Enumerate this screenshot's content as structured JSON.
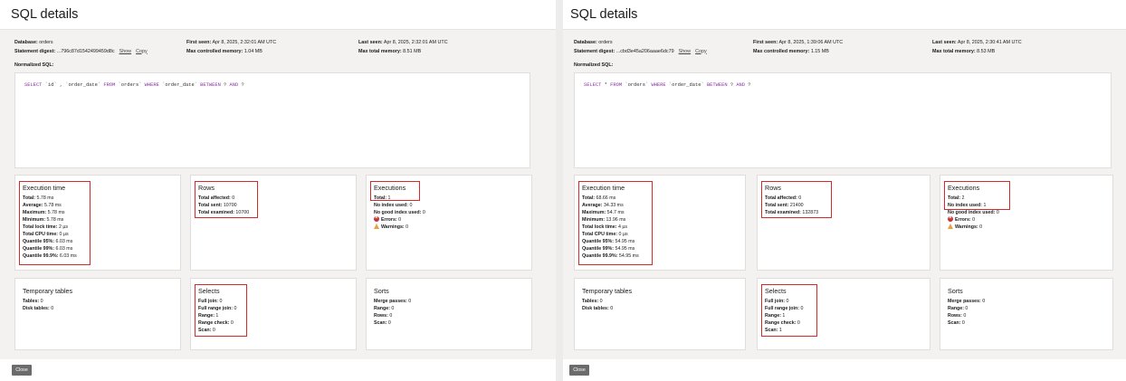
{
  "left": {
    "title": "SQL details",
    "meta": {
      "database_label": "Database:",
      "database": "orders",
      "digest_label": "Statement digest:",
      "digest": "...796c87d1542499459d8c",
      "show_label": "Show",
      "copy_label": "Copy",
      "first_seen_label": "First seen:",
      "first_seen": "Apr 8, 2025, 2:32:01 AM UTC",
      "max_controlled_label": "Max controlled memory:",
      "max_controlled": "1.04 MB",
      "last_seen_label": "Last seen:",
      "last_seen": "Apr 8, 2025, 2:32:01 AM UTC",
      "max_total_label": "Max total memory:",
      "max_total": "8.51 MB",
      "normalized_label": "Normalized SQL:"
    },
    "sql": [
      {
        "t": "SELECT",
        "k": true
      },
      {
        "t": " `id` , `order_date` ",
        "k": false
      },
      {
        "t": "FROM",
        "k": true
      },
      {
        "t": " `orders` ",
        "k": false
      },
      {
        "t": "WHERE",
        "k": true
      },
      {
        "t": " `order_date` ",
        "k": false
      },
      {
        "t": "BETWEEN",
        "k": true
      },
      {
        "t": " ? ",
        "k": false
      },
      {
        "t": "AND",
        "k": true
      },
      {
        "t": " ?",
        "k": false
      }
    ],
    "execution_time": {
      "title": "Execution time",
      "items": [
        {
          "label": "Total:",
          "value": "5.78 ms"
        },
        {
          "label": "Average:",
          "value": "5.78 ms"
        },
        {
          "label": "Maximum:",
          "value": "5.78 ms"
        },
        {
          "label": "Minimum:",
          "value": "5.78 ms"
        },
        {
          "label": "Total lock time:",
          "value": "2 µs"
        },
        {
          "label": "Total CPU time:",
          "value": "0 µs"
        },
        {
          "label": "Quantile 95%:",
          "value": "6.03 ms"
        },
        {
          "label": "Quantile 99%:",
          "value": "6.03 ms"
        },
        {
          "label": "Quantile 99.9%:",
          "value": "6.03 ms"
        }
      ]
    },
    "rows": {
      "title": "Rows",
      "items": [
        {
          "label": "Total affected:",
          "value": "0"
        },
        {
          "label": "Total sent:",
          "value": "10700"
        },
        {
          "label": "Total examined:",
          "value": "10700"
        }
      ]
    },
    "executions": {
      "title": "Executions",
      "items": [
        {
          "label": "Total:",
          "value": "1"
        },
        {
          "label": "No index used:",
          "value": "0"
        },
        {
          "label": "No good index used:",
          "value": "0"
        },
        {
          "label": "Errors:",
          "value": "0",
          "icon": "error-icon"
        },
        {
          "label": "Warnings:",
          "value": "0",
          "icon": "warning-icon"
        }
      ]
    },
    "temporary_tables": {
      "title": "Temporary tables",
      "items": [
        {
          "label": "Tables:",
          "value": "0"
        },
        {
          "label": "Disk tables:",
          "value": "0"
        }
      ]
    },
    "selects": {
      "title": "Selects",
      "items": [
        {
          "label": "Full join:",
          "value": "0"
        },
        {
          "label": "Full range join:",
          "value": "0"
        },
        {
          "label": "Range:",
          "value": "1"
        },
        {
          "label": "Range check:",
          "value": "0"
        },
        {
          "label": "Scan:",
          "value": "0"
        }
      ]
    },
    "sorts": {
      "title": "Sorts",
      "items": [
        {
          "label": "Merge passes:",
          "value": "0"
        },
        {
          "label": "Range:",
          "value": "0"
        },
        {
          "label": "Rows:",
          "value": "0"
        },
        {
          "label": "Scan:",
          "value": "0"
        }
      ]
    },
    "close_label": "Close"
  },
  "right": {
    "title": "SQL details",
    "meta": {
      "database_label": "Database:",
      "database": "orders",
      "digest_label": "Statement digest:",
      "digest": "...cbd3e45a206aaae6dc79",
      "show_label": "Show",
      "copy_label": "Copy",
      "first_seen_label": "First seen:",
      "first_seen": "Apr 8, 2025, 1:39:06 AM UTC",
      "max_controlled_label": "Max controlled memory:",
      "max_controlled": "1.15 MB",
      "last_seen_label": "Last seen:",
      "last_seen": "Apr 8, 2025, 2:30:41 AM UTC",
      "max_total_label": "Max total memory:",
      "max_total": "8.53 MB",
      "normalized_label": "Normalized SQL:"
    },
    "sql": [
      {
        "t": "SELECT",
        "k": true
      },
      {
        "t": " * ",
        "k": false
      },
      {
        "t": "FROM",
        "k": true
      },
      {
        "t": " `orders` ",
        "k": false
      },
      {
        "t": "WHERE",
        "k": true
      },
      {
        "t": " `order_date` ",
        "k": false
      },
      {
        "t": "BETWEEN",
        "k": true
      },
      {
        "t": " ? ",
        "k": false
      },
      {
        "t": "AND",
        "k": true
      },
      {
        "t": " ?",
        "k": false
      }
    ],
    "execution_time": {
      "title": "Execution time",
      "items": [
        {
          "label": "Total:",
          "value": "68.66 ms"
        },
        {
          "label": "Average:",
          "value": "34.33 ms"
        },
        {
          "label": "Maximum:",
          "value": "54.7 ms"
        },
        {
          "label": "Minimum:",
          "value": "13.96 ms"
        },
        {
          "label": "Total lock time:",
          "value": "4 µs"
        },
        {
          "label": "Total CPU time:",
          "value": "0 µs"
        },
        {
          "label": "Quantile 95%:",
          "value": "54.95 ms"
        },
        {
          "label": "Quantile 99%:",
          "value": "54.95 ms"
        },
        {
          "label": "Quantile 99.9%:",
          "value": "54.95 ms"
        }
      ]
    },
    "rows": {
      "title": "Rows",
      "items": [
        {
          "label": "Total affected:",
          "value": "0"
        },
        {
          "label": "Total sent:",
          "value": "21400"
        },
        {
          "label": "Total examined:",
          "value": "132873"
        }
      ]
    },
    "executions": {
      "title": "Executions",
      "items": [
        {
          "label": "Total:",
          "value": "2"
        },
        {
          "label": "No index used:",
          "value": "1"
        },
        {
          "label": "No good index used:",
          "value": "0"
        },
        {
          "label": "Errors:",
          "value": "0",
          "icon": "error-icon"
        },
        {
          "label": "Warnings:",
          "value": "0",
          "icon": "warning-icon"
        }
      ]
    },
    "temporary_tables": {
      "title": "Temporary tables",
      "items": [
        {
          "label": "Tables:",
          "value": "0"
        },
        {
          "label": "Disk tables:",
          "value": "0"
        }
      ]
    },
    "selects": {
      "title": "Selects",
      "items": [
        {
          "label": "Full join:",
          "value": "0"
        },
        {
          "label": "Full range join:",
          "value": "0"
        },
        {
          "label": "Range:",
          "value": "1"
        },
        {
          "label": "Range check:",
          "value": "0"
        },
        {
          "label": "Scan:",
          "value": "1"
        }
      ]
    },
    "sorts": {
      "title": "Sorts",
      "items": [
        {
          "label": "Merge passes:",
          "value": "0"
        },
        {
          "label": "Range:",
          "value": "0"
        },
        {
          "label": "Rows:",
          "value": "0"
        },
        {
          "label": "Scan:",
          "value": "0"
        }
      ]
    },
    "close_label": "Close"
  },
  "highlight_color": "#d42a2a",
  "sql_keyword_color": "#8e2fa8"
}
